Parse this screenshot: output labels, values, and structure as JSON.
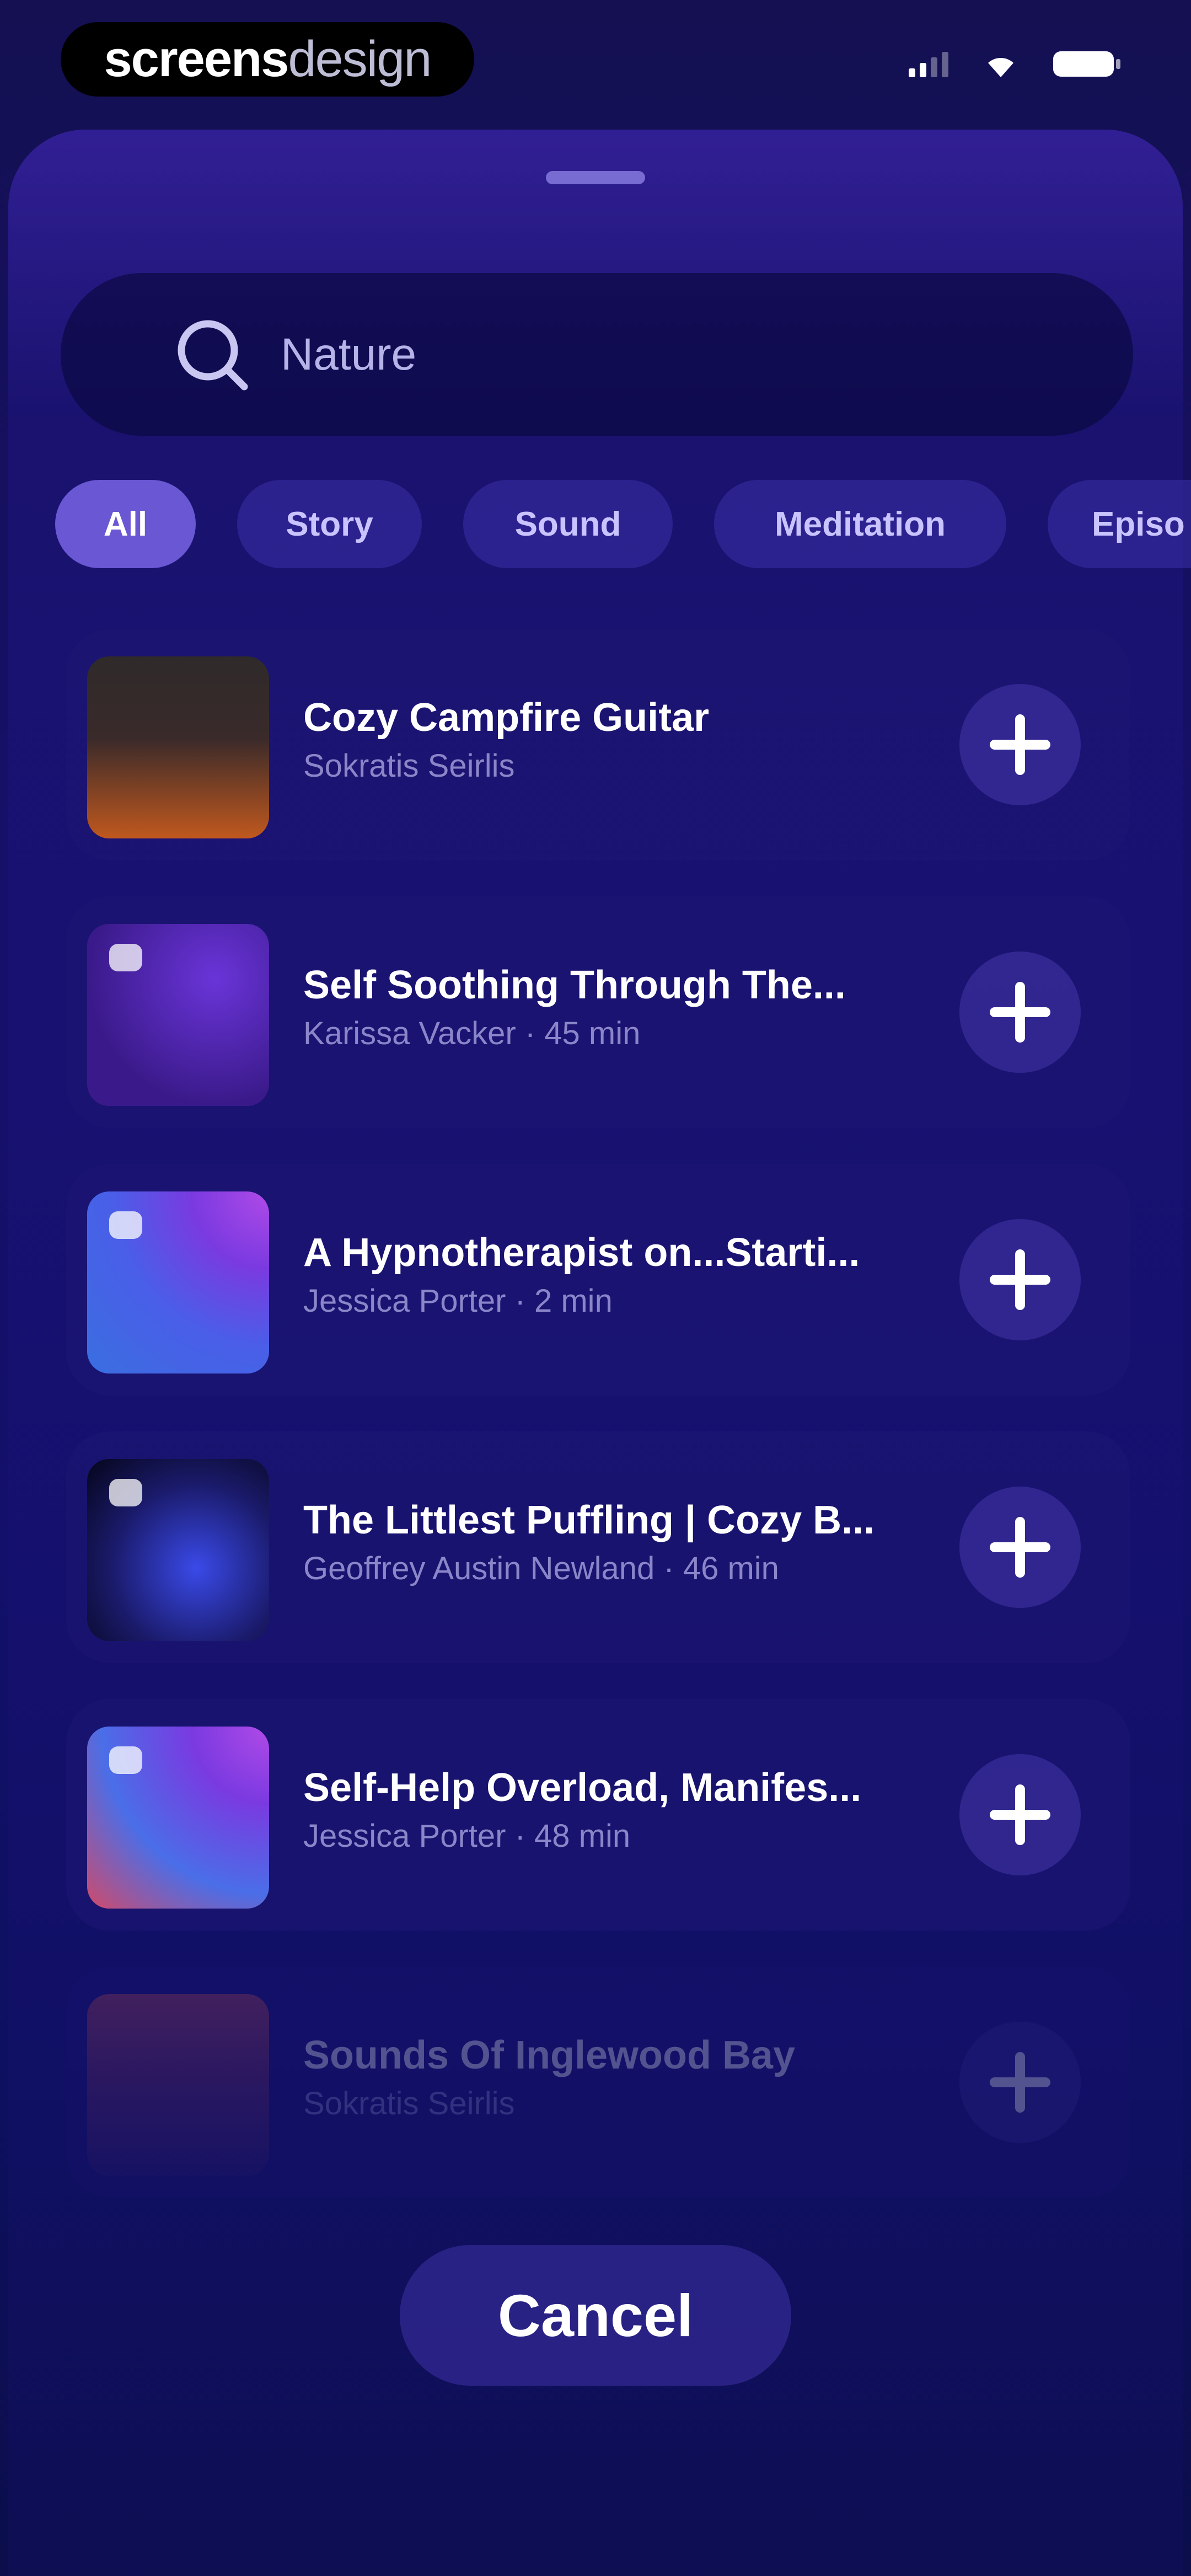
{
  "status_bar": {
    "brand_bold": "screens",
    "brand_light": "design"
  },
  "search": {
    "value": "Nature",
    "icon": "search-icon"
  },
  "filters": [
    {
      "label": "All",
      "active": true
    },
    {
      "label": "Story",
      "active": false
    },
    {
      "label": "Sound",
      "active": false
    },
    {
      "label": "Meditation",
      "active": false
    },
    {
      "label": "Episo",
      "active": false
    }
  ],
  "items": [
    {
      "title": "Cozy Campfire Guitar",
      "subtitle": "Sokratis Seirlis",
      "thumb_colors": [
        "#3a2a2a",
        "#c0581e"
      ]
    },
    {
      "title": "Self Soothing Through The...",
      "subtitle": "Karissa Vacker · 45 min",
      "thumb_colors": [
        "#3a1a8a",
        "#5a2cc8"
      ]
    },
    {
      "title": "A Hypnotherapist on...Starti...",
      "subtitle": "Jessica Porter · 2 min",
      "thumb_colors": [
        "#3a5ee0",
        "#9a44e6"
      ]
    },
    {
      "title": "The Littlest Puffling | Cozy B...",
      "subtitle": "Geoffrey Austin Newland · 46 min",
      "thumb_colors": [
        "#0a0a3a",
        "#2a3ae0"
      ]
    },
    {
      "title": "Self-Help Overload, Manifes...",
      "subtitle": "Jessica Porter · 48 min",
      "thumb_colors": [
        "#3a6ee8",
        "#a24ae8"
      ]
    },
    {
      "title": "Sounds Of Inglewood Bay",
      "subtitle": "Sokratis Seirlis",
      "thumb_colors": [
        "#a63a3a",
        "#2a1a6a"
      ]
    }
  ],
  "cancel_label": "Cancel"
}
